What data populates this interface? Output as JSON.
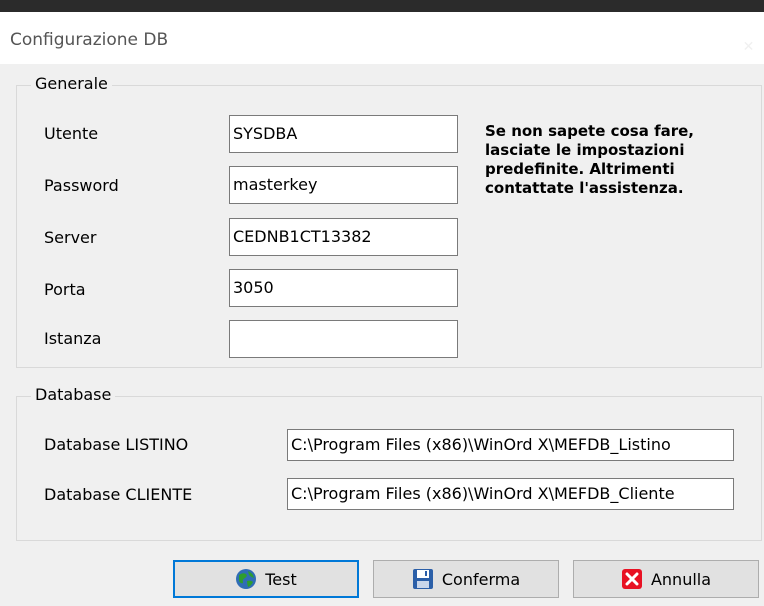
{
  "window": {
    "title": "Configurazione DB",
    "close_glyph": "✕"
  },
  "generale": {
    "legend": "Generale",
    "fields": [
      {
        "label": "Utente",
        "value": "SYSDBA"
      },
      {
        "label": "Password",
        "value": "masterkey"
      },
      {
        "label": "Server",
        "value": "CEDNB1CT13382"
      },
      {
        "label": "Porta",
        "value": "3050"
      },
      {
        "label": "Istanza",
        "value": ""
      }
    ],
    "note": "Se non sapete cosa fare, lasciate le impostazioni predefinite. Altrimenti contattate l'assistenza."
  },
  "database": {
    "legend": "Database",
    "fields": [
      {
        "label": "Database LISTINO",
        "value": "C:\\Program Files (x86)\\WinOrd X\\MEFDB_Listino"
      },
      {
        "label": "Database CLIENTE",
        "value": "C:\\Program Files (x86)\\WinOrd X\\MEFDB_Cliente"
      }
    ]
  },
  "buttons": {
    "test": {
      "label": "Test",
      "icon": "globe-icon"
    },
    "conferma": {
      "label": "Conferma",
      "icon": "floppy-disk-icon"
    },
    "annulla": {
      "label": "Annulla",
      "icon": "red-x-icon"
    }
  },
  "colors": {
    "accent": "#0078d7",
    "cancel_red": "#e81123",
    "globe_green": "#2e9e2e",
    "globe_blue": "#2f6db5",
    "disk_blue": "#2b5fa8"
  }
}
